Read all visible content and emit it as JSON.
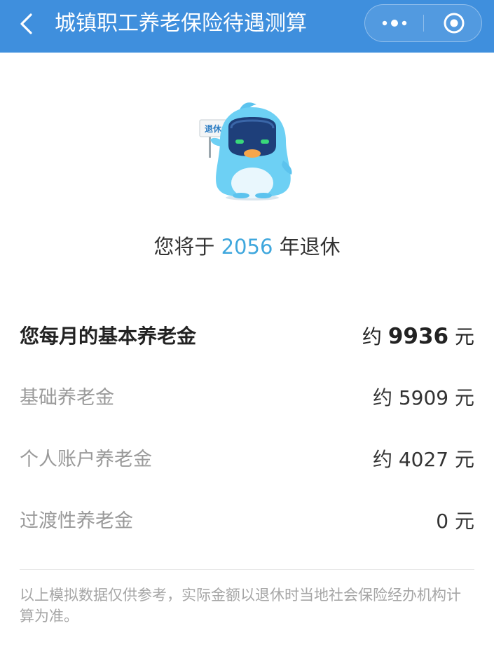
{
  "header": {
    "title": "城镇职工养老保险待遇测算",
    "back_icon": "chevron-left-icon",
    "more_icon": "more-dots-icon",
    "close_icon": "target-circle-icon",
    "background_color": "#3f8fdd"
  },
  "mascot": {
    "sign_text": "退休",
    "icon": "mascot-character"
  },
  "retirement": {
    "prefix": "您将于 ",
    "year": "2056",
    "suffix": " 年退休",
    "year_color": "#3fa7dd"
  },
  "pension": {
    "total": {
      "label": "您每月的基本养老金",
      "prefix": "约 ",
      "amount": "9936",
      "unit": " 元"
    },
    "items": [
      {
        "label": "基础养老金",
        "value": "约 5909 元"
      },
      {
        "label": "个人账户养老金",
        "value": "约 4027 元"
      },
      {
        "label": "过渡性养老金",
        "value": "0 元"
      }
    ]
  },
  "disclaimer": "以上模拟数据仅供参考，实际金额以退休时当地社会保险经办机构计算为准。"
}
